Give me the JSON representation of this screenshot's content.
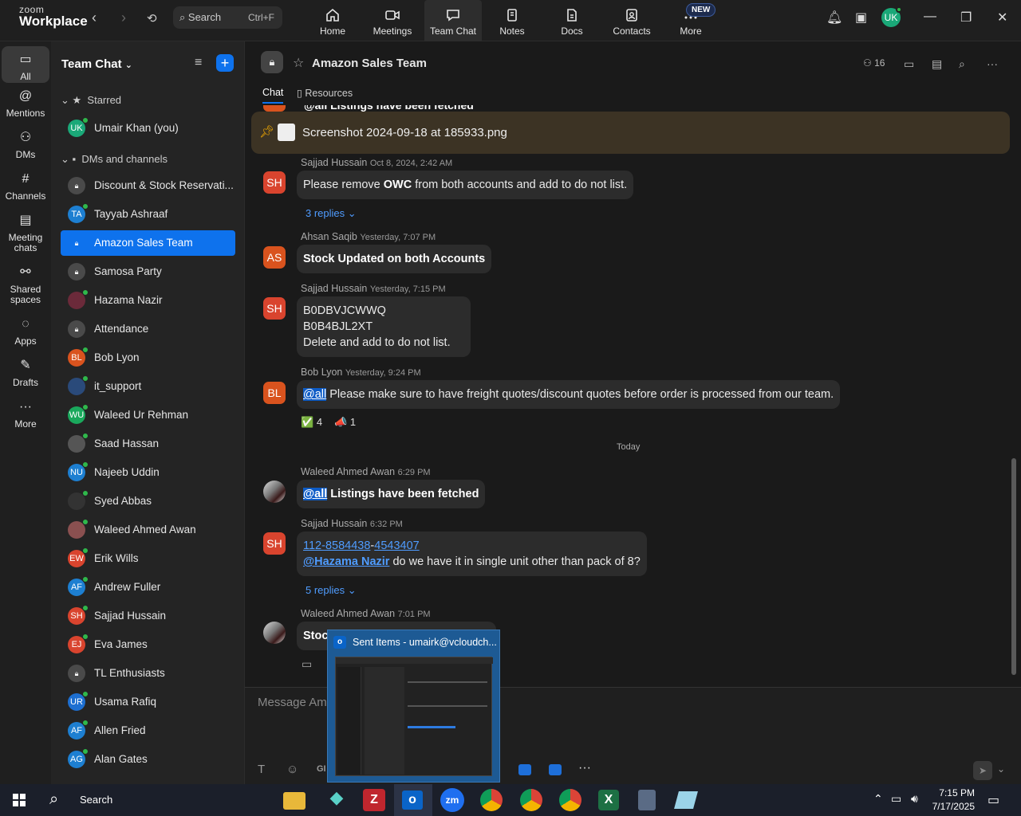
{
  "app": {
    "brand_top": "zoom",
    "brand_bottom": "Workplace"
  },
  "search": {
    "label": "Search",
    "shortcut": "Ctrl+F"
  },
  "top_nav": [
    {
      "label": "Home",
      "icon": "home-icon"
    },
    {
      "label": "Meetings",
      "icon": "video-icon"
    },
    {
      "label": "Team Chat",
      "icon": "chat-icon"
    },
    {
      "label": "Notes",
      "icon": "notes-icon"
    },
    {
      "label": "Docs",
      "icon": "docs-icon"
    },
    {
      "label": "Contacts",
      "icon": "contacts-icon"
    },
    {
      "label": "More",
      "icon": "more-icon"
    }
  ],
  "new_badge": "NEW",
  "user_initials": "UK",
  "rail": [
    {
      "label": "All",
      "icon": "chat-icon"
    },
    {
      "label": "Mentions",
      "icon": "at-icon"
    },
    {
      "label": "DMs",
      "icon": "people-icon"
    },
    {
      "label": "Channels",
      "icon": "hash-icon"
    },
    {
      "label": "Meeting chats",
      "icon": "calendar-icon"
    },
    {
      "label": "Shared spaces",
      "icon": "share-icon"
    },
    {
      "label": "Apps",
      "icon": "apps-icon"
    },
    {
      "label": "Drafts",
      "icon": "drafts-icon"
    },
    {
      "label": "More",
      "icon": "more-icon"
    }
  ],
  "sidebar": {
    "title": "Team Chat",
    "starred_label": "Starred",
    "dms_label": "DMs and channels",
    "starred": [
      {
        "label": "Umair Khan (you)",
        "initials": "UK"
      }
    ],
    "items": [
      {
        "label": "Discount & Stock Reservati...",
        "initials": "",
        "lock": true
      },
      {
        "label": "Tayyab Ashraaf",
        "initials": "TA"
      },
      {
        "label": "Amazon Sales Team",
        "initials": "",
        "lock": true
      },
      {
        "label": "Samosa Party",
        "initials": "",
        "lock": true
      },
      {
        "label": "Hazama Nazir",
        "initials": ""
      },
      {
        "label": "Attendance",
        "initials": "",
        "lock": true
      },
      {
        "label": "Bob Lyon",
        "initials": "BL"
      },
      {
        "label": "it_support",
        "initials": ""
      },
      {
        "label": "Waleed Ur Rehman",
        "initials": "WU"
      },
      {
        "label": "Saad Hassan",
        "initials": ""
      },
      {
        "label": "Najeeb Uddin",
        "initials": "NU"
      },
      {
        "label": "Syed Abbas",
        "initials": ""
      },
      {
        "label": "Waleed Ahmed Awan",
        "initials": ""
      },
      {
        "label": "Erik Wills",
        "initials": "EW"
      },
      {
        "label": "Andrew Fuller",
        "initials": "AF"
      },
      {
        "label": "Sajjad Hussain",
        "initials": "SH"
      },
      {
        "label": "Eva James",
        "initials": "EJ"
      },
      {
        "label": "TL Enthusiasts",
        "initials": "",
        "lock": true
      },
      {
        "label": "Usama Rafiq",
        "initials": "UR"
      },
      {
        "label": "Allen Fried",
        "initials": "AF"
      },
      {
        "label": "Alan Gates",
        "initials": "AG"
      }
    ]
  },
  "chat": {
    "title": "Amazon Sales Team",
    "member_count": "16",
    "tabs": [
      "Chat",
      "Resources"
    ],
    "pinned_file": "Screenshot 2024-09-18 at 185933.png",
    "cut_off_text": "@all Listings have been fetched",
    "cut_off_initials": "AS",
    "messages": [
      {
        "name": "Sajjad Hussain",
        "time": "Oct 8, 2024, 2:42 AM",
        "initials": "SH",
        "pre": "Please remove ",
        "bold": "OWC",
        "post": " from both accounts and add to do not list.",
        "replies": "3 replies"
      },
      {
        "name": "Ahsan Saqib",
        "time": "Yesterday, 7:07 PM",
        "initials": "AS",
        "text": "Stock Updated on both Accounts"
      },
      {
        "name": "Sajjad Hussain",
        "time": "Yesterday, 7:15 PM",
        "initials": "SH",
        "lines": [
          "B0DBVJCWWQ",
          "B0B4BJL2XT",
          "Delete and add to do not list."
        ]
      },
      {
        "name": "Bob Lyon",
        "time": "Yesterday, 9:24 PM",
        "initials": "BL",
        "mention": "@all",
        "text": " Please make sure to have freight quotes/discount quotes before order is processed from our team.",
        "reactions": [
          {
            "emoji": "✅",
            "count": "4"
          },
          {
            "emoji": "📣",
            "count": "1"
          }
        ]
      },
      {
        "name": "Waleed Ahmed Awan",
        "time": "6:29 PM",
        "mention": "@all",
        "text": " Listings have been fetched"
      },
      {
        "name": "Sajjad Hussain",
        "time": "6:32 PM",
        "initials": "SH",
        "link1": "112-8584438",
        "dash": "-",
        "link2": "4543407",
        "mention": "@Hazama Nazir",
        "text": " do we have it in single unit other than pack of 8?",
        "replies": "5 replies"
      },
      {
        "name": "Waleed Ahmed Awan",
        "time": "7:01 PM",
        "text": "Stoc"
      }
    ],
    "divider": "Today",
    "composer_placeholder": "Message Ama"
  },
  "popup": {
    "title": "Sent Items - umairk@vcloudch..."
  },
  "taskbar": {
    "search": "Search",
    "time": "7:15 PM",
    "date": "7/17/2025"
  },
  "colors": {
    "accent": "#0e72ed",
    "pinned_bg": "#3c3324"
  }
}
